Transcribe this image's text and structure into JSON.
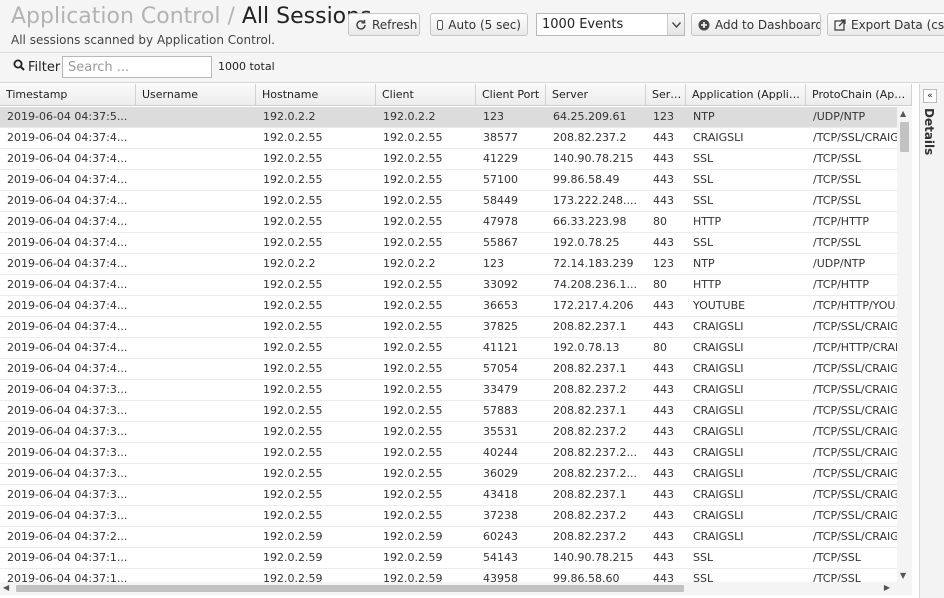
{
  "header": {
    "app_name": "Application Control",
    "separator": "/",
    "page_title": "All Sessions",
    "subtitle": "All sessions scanned by Application Control."
  },
  "toolbar": {
    "refresh_label": "Refresh",
    "auto_label": "Auto (5 sec)",
    "events_selected": "1000 Events",
    "add_dashboard_label": "Add to Dashboard",
    "export_label": "Export Data (csv)"
  },
  "filter": {
    "label": "Filter",
    "placeholder": "Search ...",
    "value": "",
    "total_text": "1000 total"
  },
  "details_panel": {
    "label": "Details"
  },
  "table": {
    "columns": [
      "Timestamp",
      "Username",
      "Hostname",
      "Client",
      "Client Port",
      "Server",
      "Server Port",
      "Application (Application Control)",
      "ProtoChain (Application Control)"
    ],
    "rows": [
      [
        "2019-06-04 04:37:5...",
        "",
        "192.0.2.2",
        "192.0.2.2",
        "123",
        "64.25.209.61",
        "123",
        "NTP",
        "/UDP/NTP"
      ],
      [
        "2019-06-04 04:37:4...",
        "",
        "192.0.2.55",
        "192.0.2.55",
        "38577",
        "208.82.237.2",
        "443",
        "CRAIGSLI",
        "/TCP/SSL/CRAIGSLI"
      ],
      [
        "2019-06-04 04:37:4...",
        "",
        "192.0.2.55",
        "192.0.2.55",
        "41229",
        "140.90.78.215",
        "443",
        "SSL",
        "/TCP/SSL"
      ],
      [
        "2019-06-04 04:37:4...",
        "",
        "192.0.2.55",
        "192.0.2.55",
        "57100",
        "99.86.58.49",
        "443",
        "SSL",
        "/TCP/SSL"
      ],
      [
        "2019-06-04 04:37:4...",
        "",
        "192.0.2.55",
        "192.0.2.55",
        "58449",
        "173.222.248....",
        "443",
        "SSL",
        "/TCP/SSL"
      ],
      [
        "2019-06-04 04:37:4...",
        "",
        "192.0.2.55",
        "192.0.2.55",
        "47978",
        "66.33.223.98",
        "80",
        "HTTP",
        "/TCP/HTTP"
      ],
      [
        "2019-06-04 04:37:4...",
        "",
        "192.0.2.55",
        "192.0.2.55",
        "55867",
        "192.0.78.25",
        "443",
        "SSL",
        "/TCP/SSL"
      ],
      [
        "2019-06-04 04:37:4...",
        "",
        "192.0.2.2",
        "192.0.2.2",
        "123",
        "72.14.183.239",
        "123",
        "NTP",
        "/UDP/NTP"
      ],
      [
        "2019-06-04 04:37:4...",
        "",
        "192.0.2.55",
        "192.0.2.55",
        "33092",
        "74.208.236.1...",
        "80",
        "HTTP",
        "/TCP/HTTP"
      ],
      [
        "2019-06-04 04:37:4...",
        "",
        "192.0.2.55",
        "192.0.2.55",
        "36653",
        "172.217.4.206",
        "443",
        "YOUTUBE",
        "/TCP/HTTP/YOUTUBE"
      ],
      [
        "2019-06-04 04:37:4...",
        "",
        "192.0.2.55",
        "192.0.2.55",
        "37825",
        "208.82.237.1",
        "443",
        "CRAIGSLI",
        "/TCP/SSL/CRAIGSLI"
      ],
      [
        "2019-06-04 04:37:4...",
        "",
        "192.0.2.55",
        "192.0.2.55",
        "41121",
        "192.0.78.13",
        "80",
        "CRAIGSLI",
        "/TCP/HTTP/CRAIGSLI"
      ],
      [
        "2019-06-04 04:37:4...",
        "",
        "192.0.2.55",
        "192.0.2.55",
        "57054",
        "208.82.237.1",
        "443",
        "CRAIGSLI",
        "/TCP/SSL/CRAIGSLI"
      ],
      [
        "2019-06-04 04:37:3...",
        "",
        "192.0.2.55",
        "192.0.2.55",
        "33479",
        "208.82.237.2",
        "443",
        "CRAIGSLI",
        "/TCP/SSL/CRAIGSLI"
      ],
      [
        "2019-06-04 04:37:3...",
        "",
        "192.0.2.55",
        "192.0.2.55",
        "57883",
        "208.82.237.1",
        "443",
        "CRAIGSLI",
        "/TCP/SSL/CRAIGSLI"
      ],
      [
        "2019-06-04 04:37:3...",
        "",
        "192.0.2.55",
        "192.0.2.55",
        "35531",
        "208.82.237.2",
        "443",
        "CRAIGSLI",
        "/TCP/SSL/CRAIGSLI"
      ],
      [
        "2019-06-04 04:37:3...",
        "",
        "192.0.2.55",
        "192.0.2.55",
        "40244",
        "208.82.237.2...",
        "443",
        "CRAIGSLI",
        "/TCP/SSL/CRAIGSLI"
      ],
      [
        "2019-06-04 04:37:3...",
        "",
        "192.0.2.55",
        "192.0.2.55",
        "36029",
        "208.82.237.2...",
        "443",
        "CRAIGSLI",
        "/TCP/SSL/CRAIGSLI"
      ],
      [
        "2019-06-04 04:37:3...",
        "",
        "192.0.2.55",
        "192.0.2.55",
        "43418",
        "208.82.237.1",
        "443",
        "CRAIGSLI",
        "/TCP/SSL/CRAIGSLI"
      ],
      [
        "2019-06-04 04:37:3...",
        "",
        "192.0.2.55",
        "192.0.2.55",
        "37238",
        "208.82.237.2",
        "443",
        "CRAIGSLI",
        "/TCP/SSL/CRAIGSLI"
      ],
      [
        "2019-06-04 04:37:2...",
        "",
        "192.0.2.59",
        "192.0.2.59",
        "60243",
        "208.82.237.2",
        "443",
        "CRAIGSLI",
        "/TCP/SSL/CRAIGSLI"
      ],
      [
        "2019-06-04 04:37:1...",
        "",
        "192.0.2.59",
        "192.0.2.59",
        "54143",
        "140.90.78.215",
        "443",
        "SSL",
        "/TCP/SSL"
      ],
      [
        "2019-06-04 04:37:1...",
        "",
        "192.0.2.59",
        "192.0.2.59",
        "43958",
        "99.86.58.60",
        "443",
        "SSL",
        "/TCP/SSL"
      ]
    ],
    "selected_row": 0
  }
}
